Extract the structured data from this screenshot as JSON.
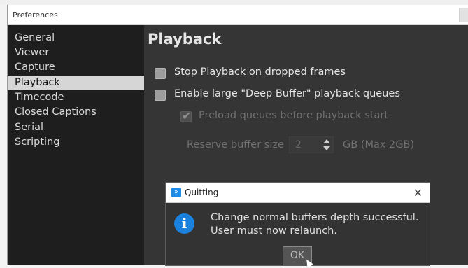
{
  "window": {
    "title": "Preferences"
  },
  "sidebar": {
    "items": [
      {
        "label": "General"
      },
      {
        "label": "Viewer"
      },
      {
        "label": "Capture"
      },
      {
        "label": "Playback"
      },
      {
        "label": "Timecode"
      },
      {
        "label": "Closed Captions"
      },
      {
        "label": "Serial"
      },
      {
        "label": "Scripting"
      }
    ],
    "selected": "Playback"
  },
  "main": {
    "title": "Playback",
    "options": {
      "stop_on_dropped": {
        "label": "Stop Playback on dropped frames",
        "checked": false
      },
      "deep_buffer": {
        "label": "Enable large \"Deep Buffer\" playback queues",
        "checked": false
      },
      "preload": {
        "label": "Preload queues before playback start",
        "checked": true,
        "enabled": false
      }
    },
    "reserve": {
      "label": "Reserve buffer size",
      "value": "2",
      "suffix": "GB (Max 2GB)"
    }
  },
  "dialog": {
    "title": "Quitting",
    "close_glyph": "✕",
    "message_line1": "Change normal buffers depth successful.",
    "message_line2": "User must now relaunch.",
    "ok_label": "OK"
  },
  "colors": {
    "accent": "#1a82de"
  }
}
